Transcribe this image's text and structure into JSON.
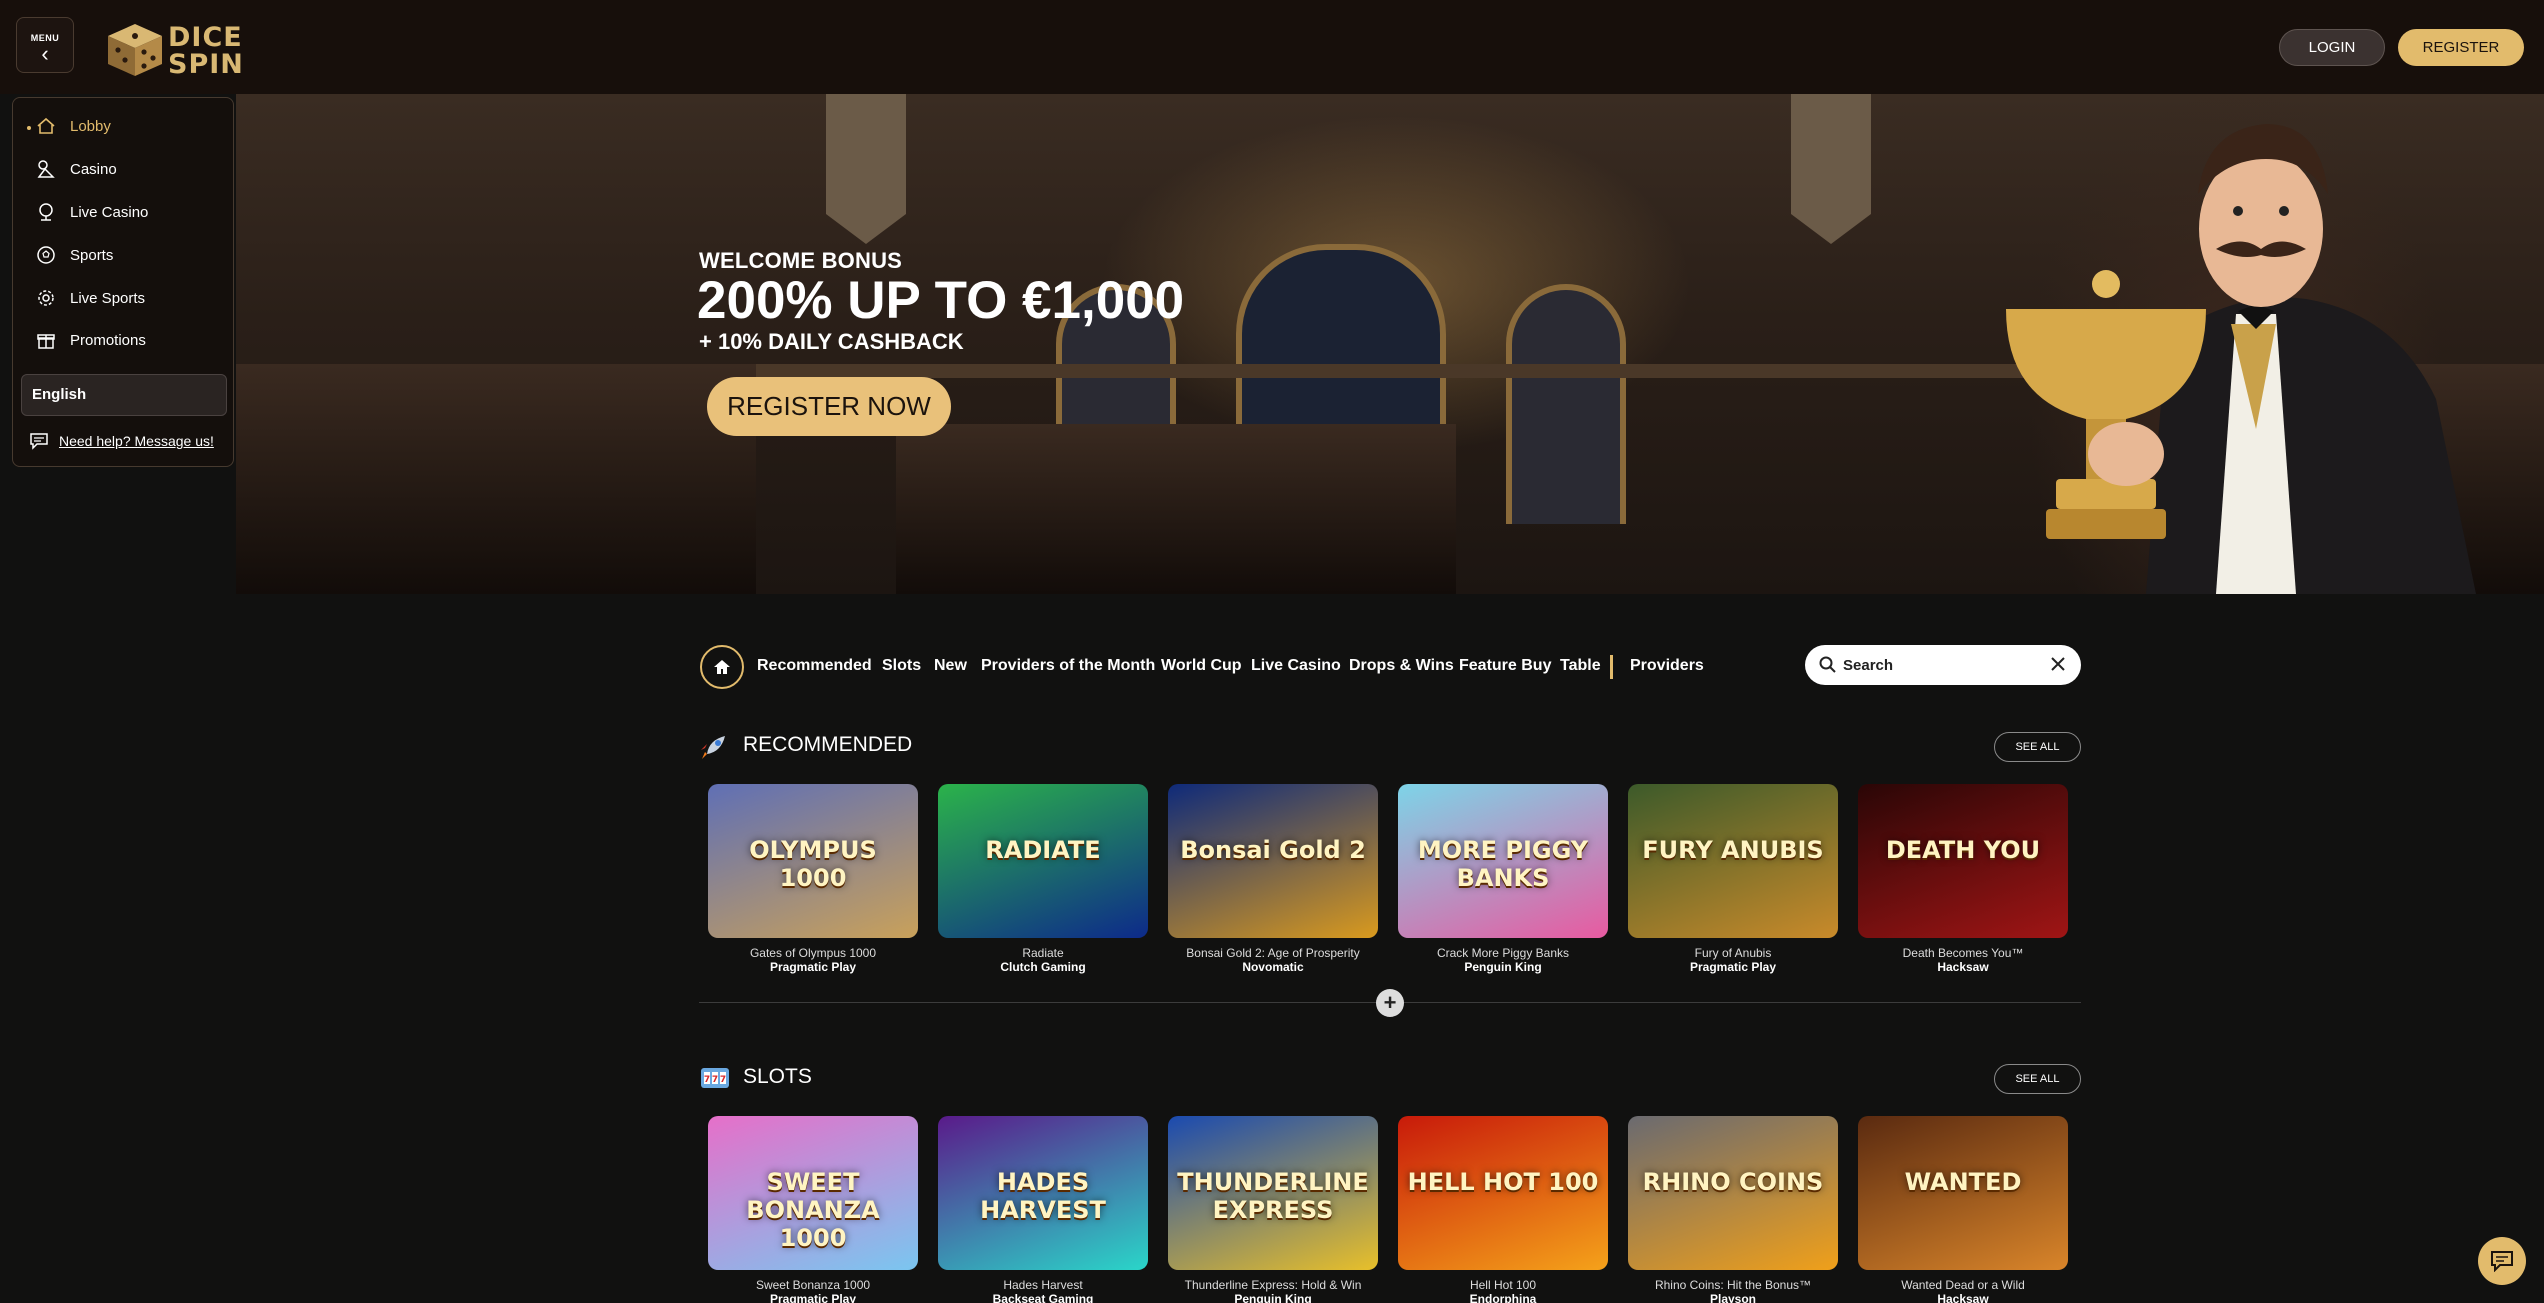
{
  "header": {
    "menu_label": "MENU",
    "logo_line1": "DICE",
    "logo_line2": "SPIN",
    "login_label": "LOGIN",
    "register_label": "REGISTER"
  },
  "sidebar": {
    "items": [
      {
        "label": "Lobby",
        "icon": "home-icon"
      },
      {
        "label": "Casino",
        "icon": "casino-icon"
      },
      {
        "label": "Live Casino",
        "icon": "live-casino-icon"
      },
      {
        "label": "Sports",
        "icon": "soccer-ball-icon"
      },
      {
        "label": "Live Sports",
        "icon": "live-sports-icon"
      },
      {
        "label": "Promotions",
        "icon": "gift-icon"
      }
    ],
    "language": "English",
    "help_text": "Need help? Message us!"
  },
  "hero": {
    "welcome": "WELCOME BONUS",
    "headline": "200% UP TO €1,000",
    "sub": "+ 10% DAILY CASHBACK",
    "cta": "REGISTER NOW"
  },
  "categories": [
    "Recommended",
    "Slots",
    "New",
    "Providers of the Month",
    "World Cup",
    "Live Casino",
    "Drops & Wins",
    "Feature Buy",
    "Table",
    "Providers"
  ],
  "search": {
    "placeholder": "Search"
  },
  "sections": [
    {
      "title": "RECOMMENDED",
      "icon": "rocket-icon",
      "see_all": "SEE ALL",
      "games": [
        {
          "name": "Gates of Olympus 1000",
          "provider": "Pragmatic Play",
          "art": "OLYMPUS 1000",
          "colors": [
            "#5f6fb5",
            "#c9a15a"
          ]
        },
        {
          "name": "Radiate",
          "provider": "Clutch Gaming",
          "art": "RADIATE",
          "colors": [
            "#2bb34a",
            "#0d2a8a"
          ]
        },
        {
          "name": "Bonsai Gold 2: Age of Prosperity",
          "provider": "Novomatic",
          "art": "Bonsai Gold 2",
          "colors": [
            "#0e2a7a",
            "#d99a1e"
          ]
        },
        {
          "name": "Crack More Piggy Banks",
          "provider": "Penguin King",
          "art": "MORE PIGGY BANKS",
          "colors": [
            "#7dd4e8",
            "#e85aa0"
          ]
        },
        {
          "name": "Fury of Anubis",
          "provider": "Pragmatic Play",
          "art": "FURY ANUBIS",
          "colors": [
            "#3c5a2a",
            "#c98a2a"
          ]
        },
        {
          "name": "Death Becomes You™",
          "provider": "Hacksaw",
          "art": "DEATH YOU",
          "colors": [
            "#2a0606",
            "#a01515"
          ]
        }
      ]
    },
    {
      "title": "SLOTS",
      "icon": "slot-machine-icon",
      "see_all": "SEE ALL",
      "games": [
        {
          "name": "Sweet Bonanza 1000",
          "provider": "Pragmatic Play",
          "art": "SWEET BONANZA 1000",
          "colors": [
            "#e66fc9",
            "#7ac6f0"
          ]
        },
        {
          "name": "Hades Harvest",
          "provider": "Backseat Gaming",
          "art": "HADES HARVEST",
          "colors": [
            "#5a1a8a",
            "#2ad6c9"
          ]
        },
        {
          "name": "Thunderline Express: Hold & Win",
          "provider": "Penguin King",
          "art": "THUNDERLINE EXPRESS",
          "colors": [
            "#1a4ab0",
            "#e8c02a"
          ]
        },
        {
          "name": "Hell Hot 100",
          "provider": "Endorphina",
          "art": "HELL HOT 100",
          "colors": [
            "#c81a0a",
            "#f5a21a"
          ]
        },
        {
          "name": "Rhino Coins: Hit the Bonus™",
          "provider": "Playson",
          "art": "RHINO COINS",
          "colors": [
            "#6a6a70",
            "#f0a01a"
          ]
        },
        {
          "name": "Wanted Dead or a Wild",
          "provider": "Hacksaw",
          "art": "WANTED",
          "colors": [
            "#5a2a10",
            "#d9852a"
          ]
        }
      ]
    }
  ],
  "colors": {
    "accent": "#e2bb6c",
    "background": "#111110",
    "header": "#170f0b"
  }
}
